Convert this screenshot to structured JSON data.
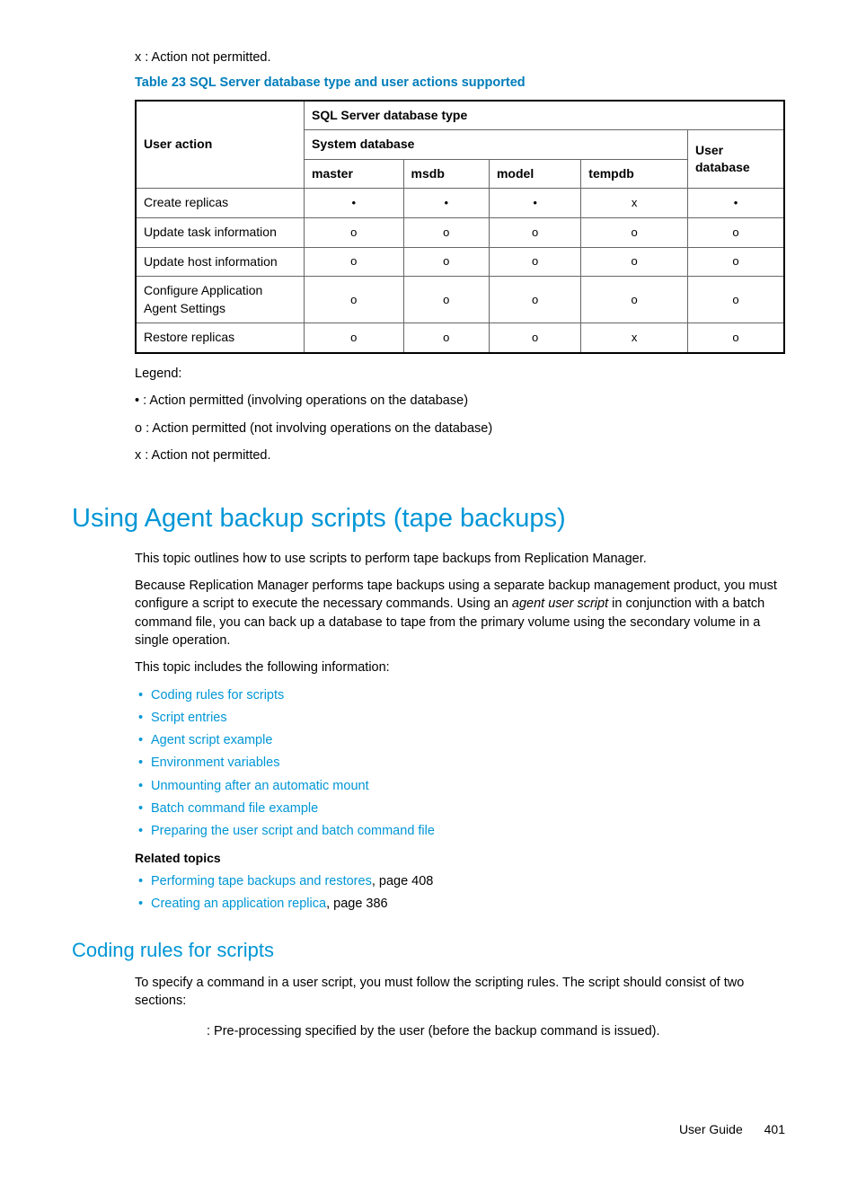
{
  "preNote": "x : Action not permitted.",
  "tableCaption": "Table 23 SQL Server database type and user actions supported",
  "tableHeaders": {
    "userAction": "User action",
    "sqlType": "SQL Server database type",
    "systemDb": "System database",
    "userDb": "User database",
    "cols": [
      "master",
      "msdb",
      "model",
      "tempdb"
    ]
  },
  "tableRows": [
    {
      "action": "Create replicas",
      "vals": [
        "•",
        "•",
        "•",
        "x",
        "•"
      ]
    },
    {
      "action": "Update task information",
      "vals": [
        "o",
        "o",
        "o",
        "o",
        "o"
      ]
    },
    {
      "action": "Update host information",
      "vals": [
        "o",
        "o",
        "o",
        "o",
        "o"
      ]
    },
    {
      "action": "Configure Application Agent Settings",
      "vals": [
        "o",
        "o",
        "o",
        "o",
        "o"
      ]
    },
    {
      "action": "Restore replicas",
      "vals": [
        "o",
        "o",
        "o",
        "x",
        "o"
      ]
    }
  ],
  "legend": {
    "title": "Legend:",
    "lines": [
      "• : Action permitted (involving operations on the database)",
      "o : Action permitted (not involving operations on the database)",
      "x : Action not permitted."
    ]
  },
  "section1": {
    "title": "Using Agent backup scripts (tape backups)",
    "p1": "This topic outlines how to use scripts to perform tape backups from Replication Manager.",
    "p2a": "Because Replication Manager performs tape backups using a separate backup management product, you must configure a script to execute the necessary commands. Using an ",
    "p2i": "agent user script",
    "p2b": " in conjunction with a batch command file, you can back up a database to tape from the primary volume using the secondary volume in a single operation.",
    "p3": "This topic includes the following information:",
    "links": [
      "Coding rules for scripts",
      "Script entries",
      "Agent script example",
      "Environment variables",
      "Unmounting after an automatic mount",
      "Batch command file example",
      "Preparing the user script and batch command file"
    ],
    "relatedHeading": "Related topics",
    "related": [
      {
        "text": "Performing tape backups and restores",
        "suffix": ", page 408"
      },
      {
        "text": "Creating an application replica",
        "suffix": ", page 386"
      }
    ]
  },
  "section2": {
    "title": "Coding rules for scripts",
    "p1": "To specify a command in a user script, you must follow the scripting rules. The script should consist of two sections:",
    "pre": ": Pre-processing specified by the user (before the backup command is issued)."
  },
  "footer": {
    "label": "User Guide",
    "page": "401"
  }
}
